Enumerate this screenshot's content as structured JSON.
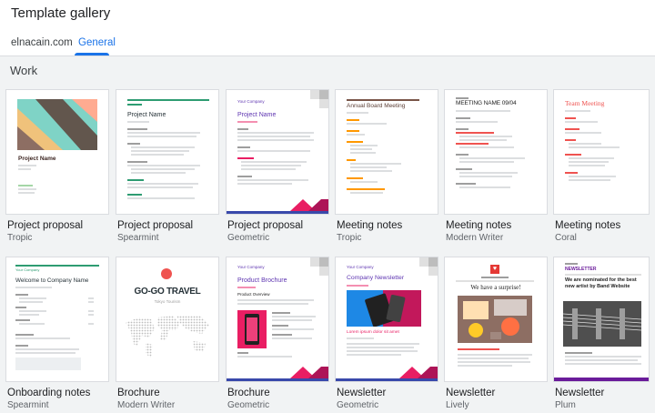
{
  "header": {
    "title": "Template gallery",
    "tabs": [
      {
        "label": "elnacain.com"
      },
      {
        "label": "General"
      }
    ]
  },
  "section": {
    "title": "Work"
  },
  "templates": [
    {
      "name": "Project proposal",
      "style": "Tropic",
      "preview_title": "Project Name"
    },
    {
      "name": "Project proposal",
      "style": "Spearmint",
      "preview_title": "Project Name"
    },
    {
      "name": "Project proposal",
      "style": "Geometric",
      "preview_title": "Project Name",
      "preview_kicker": "Your Company"
    },
    {
      "name": "Meeting notes",
      "style": "Tropic",
      "preview_title": "Annual Board Meeting"
    },
    {
      "name": "Meeting notes",
      "style": "Modern Writer",
      "preview_title": "MEETING NAME 09/04"
    },
    {
      "name": "Meeting notes",
      "style": "Coral",
      "preview_title": "Team Meeting"
    },
    {
      "name": "Onboarding notes",
      "style": "Spearmint",
      "preview_title": "Welcome to Company Name",
      "preview_kicker": "Your Company"
    },
    {
      "name": "Brochure",
      "style": "Modern Writer",
      "preview_title": "GO-GO TRAVEL",
      "preview_sub": "Tokyo Tourism"
    },
    {
      "name": "Brochure",
      "style": "Geometric",
      "preview_title": "Product Brochure",
      "preview_kicker": "Your Company",
      "preview_sub": "Product Overview"
    },
    {
      "name": "Newsletter",
      "style": "Geometric",
      "preview_title": "Company Newsletter",
      "preview_kicker": "Your Company",
      "preview_sub": "Lorem ipsum dolor sit amet"
    },
    {
      "name": "Newsletter",
      "style": "Lively",
      "preview_title": "We have a surprise!"
    },
    {
      "name": "Newsletter",
      "style": "Plum",
      "preview_title": "We are nominated for the best new artist by Band Website",
      "preview_kicker": "NEWSLETTER"
    }
  ],
  "colors": {
    "accent": "#1a73e8",
    "tropic_teal": "#7fd3c6",
    "tropic_brown": "#795548",
    "spearmint": "#2e9c72",
    "geometric_purple": "#5e35b1",
    "geometric_pink": "#e91e63",
    "coral": "#ef5350",
    "plum": "#6a1b9a"
  }
}
